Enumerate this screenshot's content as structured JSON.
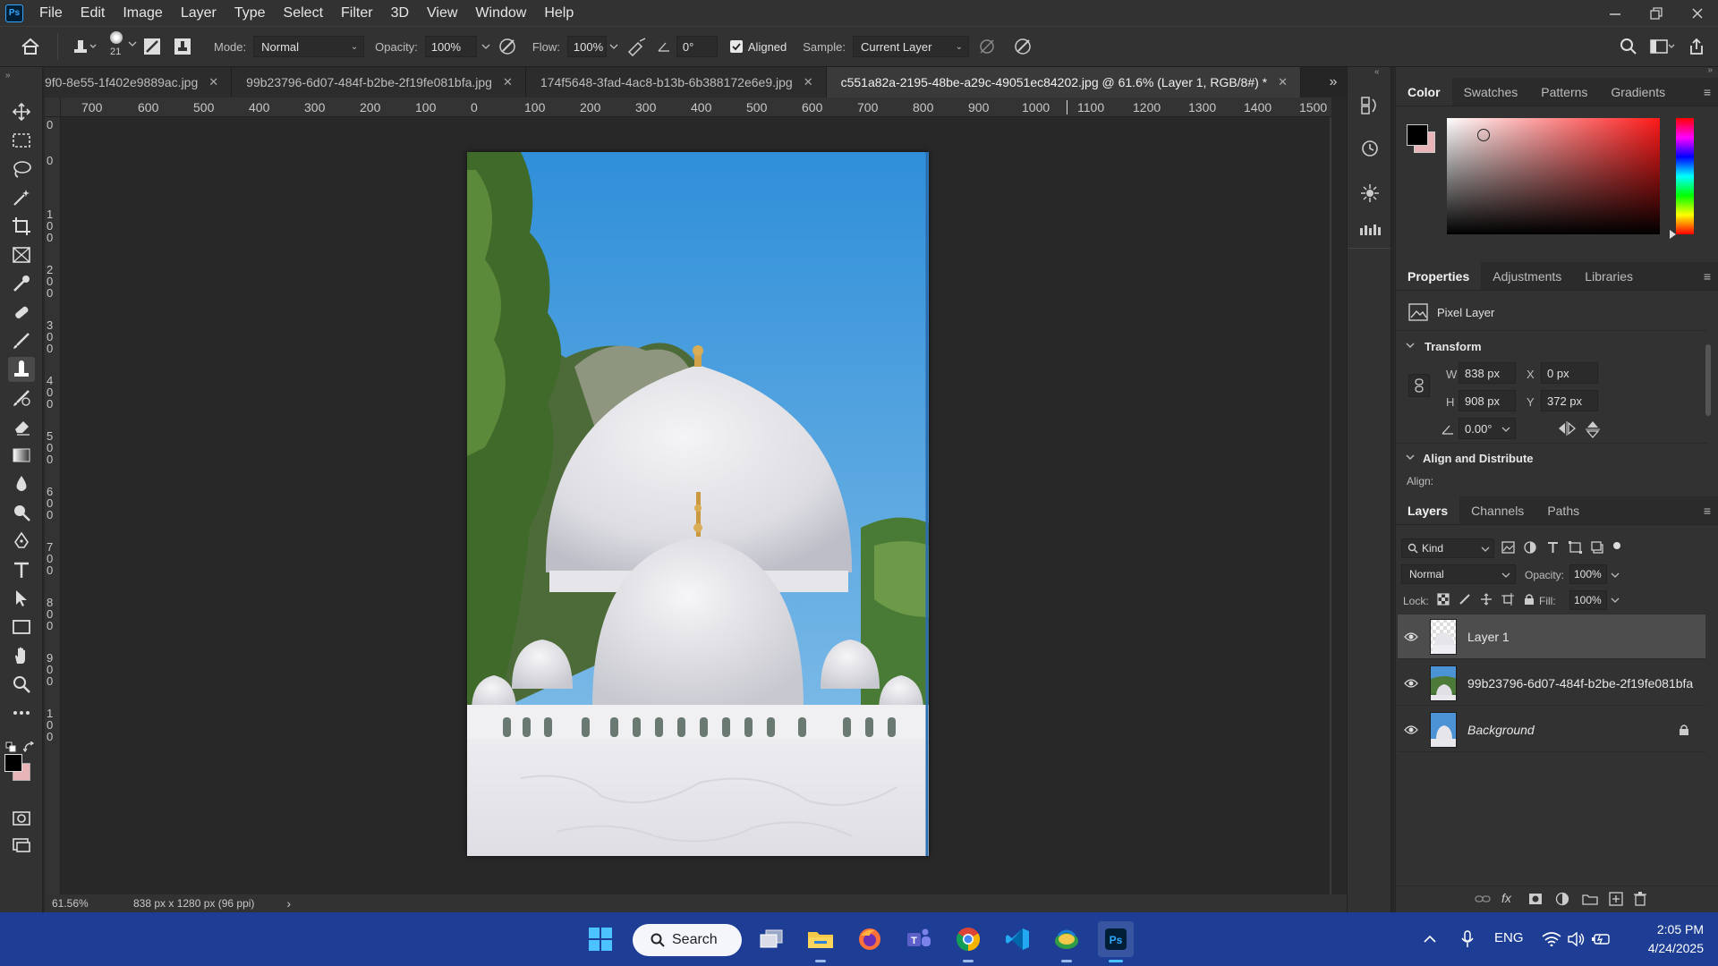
{
  "app": {
    "logo": "Ps",
    "name": "Adobe Photoshop"
  },
  "menu": [
    "File",
    "Edit",
    "Image",
    "Layer",
    "Type",
    "Select",
    "Filter",
    "3D",
    "View",
    "Window",
    "Help"
  ],
  "window_controls": {
    "minimize": "minimize-icon",
    "restore": "restore-icon",
    "close": "close-icon"
  },
  "options": {
    "brush_size": "21",
    "mode_label": "Mode:",
    "mode_value": "Normal",
    "opacity_label": "Opacity:",
    "opacity_value": "100%",
    "flow_label": "Flow:",
    "flow_value": "100%",
    "angle_value": "0°",
    "aligned_label": "Aligned",
    "aligned_checked": true,
    "sample_label": "Sample:",
    "sample_value": "Current Layer"
  },
  "tabs": [
    {
      "label": "9f0-8e55-1f402e9889ac.jpg",
      "active": false
    },
    {
      "label": "99b23796-6d07-484f-b2be-2f19fe081bfa.jpg",
      "active": false
    },
    {
      "label": "174f5648-3fad-4ac8-b13b-6b388172e6e9.jpg",
      "active": false
    },
    {
      "label": "c551a82a-2195-48be-a29c-49051ec84202.jpg @ 61.6% (Layer 1, RGB/8#) *",
      "active": true
    }
  ],
  "ruler_top": [
    "700",
    "600",
    "500",
    "400",
    "300",
    "200",
    "100",
    "0",
    "100",
    "200",
    "300",
    "400",
    "500",
    "600",
    "700",
    "800",
    "900",
    "1000",
    "1100",
    "1200",
    "1300",
    "1400",
    "1500"
  ],
  "ruler_left": [
    "0",
    "0",
    "1 0 0",
    "2 0 0",
    "3 0 0",
    "4 0 0",
    "5 0 0",
    "6 0 0",
    "7 0 0",
    "8 0 0",
    "9 0 0",
    "1 0 0"
  ],
  "status": {
    "zoom": "61.56%",
    "doc_info": "838 px x 1280 px (96 ppi)",
    "arrow": "›"
  },
  "color_panel": {
    "tabs": [
      "Color",
      "Swatches",
      "Patterns",
      "Gradients"
    ],
    "foreground": "#000000",
    "background": "#e8b4b8",
    "hue_color": "#ff1a1a"
  },
  "properties": {
    "tabs": [
      "Properties",
      "Adjustments",
      "Libraries"
    ],
    "layer_type": "Pixel Layer",
    "transform_title": "Transform",
    "w_label": "W",
    "w_value": "838 px",
    "x_label": "X",
    "x_value": "0 px",
    "h_label": "H",
    "h_value": "908 px",
    "y_label": "Y",
    "y_value": "372 px",
    "angle_value": "0.00°",
    "align_title": "Align and Distribute",
    "align_label": "Align:"
  },
  "layers_panel": {
    "tabs": [
      "Layers",
      "Channels",
      "Paths"
    ],
    "filter_label": "Kind",
    "blend_mode": "Normal",
    "opacity_label": "Opacity:",
    "opacity_value": "100%",
    "lock_label": "Lock:",
    "fill_label": "Fill:",
    "fill_value": "100%",
    "layers": [
      {
        "name": "Layer 1",
        "selected": true,
        "locked": false
      },
      {
        "name": "99b23796-6d07-484f-b2be-2f19fe081bfa",
        "selected": false,
        "locked": false
      },
      {
        "name": "Background",
        "selected": false,
        "locked": true
      }
    ]
  },
  "taskbar": {
    "search_label": "Search",
    "language": "ENG",
    "time": "2:05 PM",
    "date": "4/24/2025"
  }
}
